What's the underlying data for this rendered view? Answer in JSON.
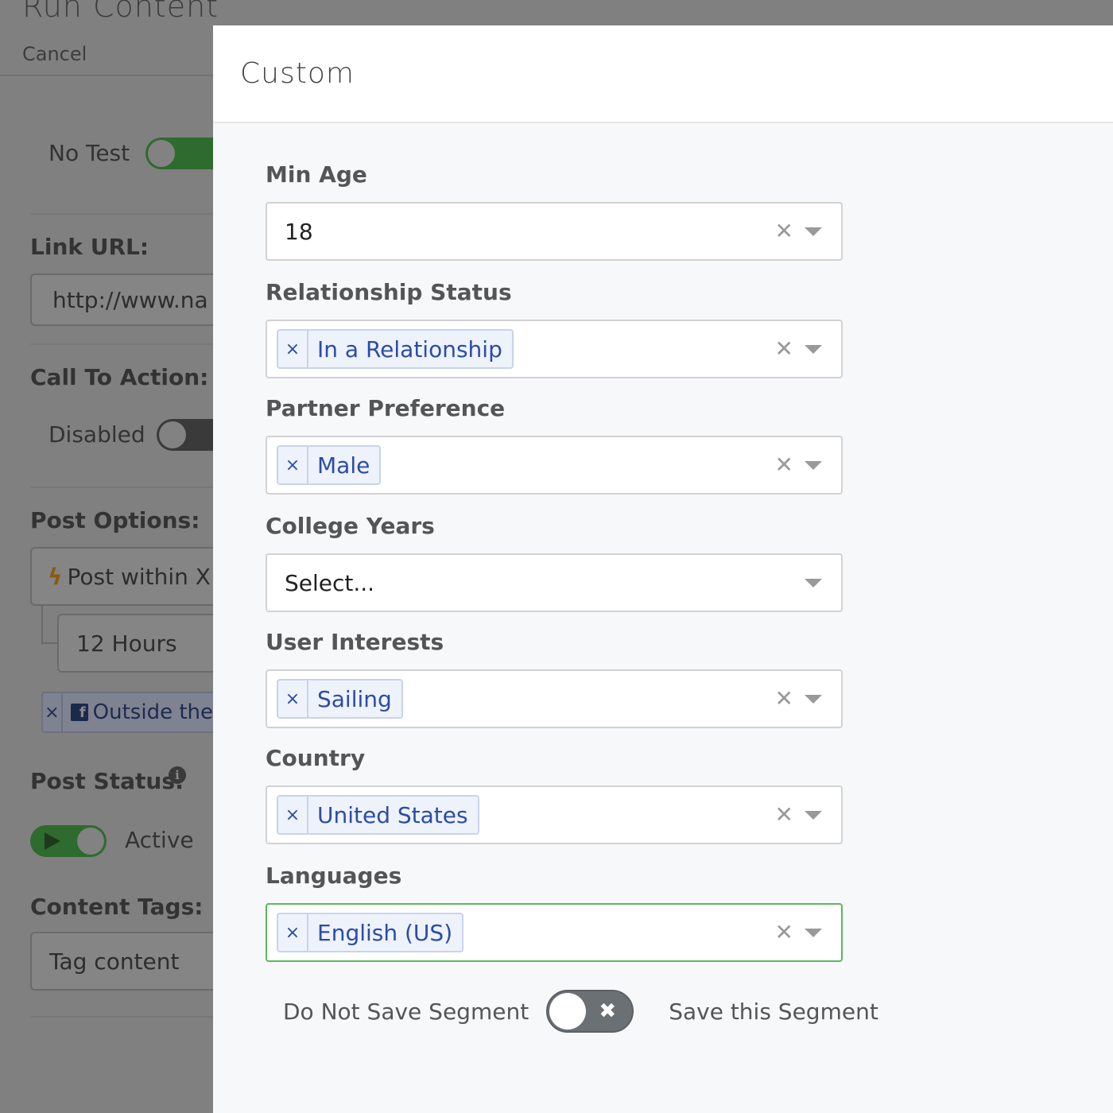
{
  "background": {
    "title": "Run Content",
    "cancel_label": "Cancel",
    "no_test_label": "No Test",
    "link_url_label": "Link URL:",
    "link_url_value": "http://www.na",
    "call_to_action_label": "Call To Action:",
    "disabled_label": "Disabled",
    "post_options_label": "Post Options:",
    "post_option_value": "Post within X I",
    "hours_value": "12 Hours",
    "outside_tag_label": "Outside the",
    "post_status_label": "Post Status:",
    "active_label": "Active",
    "content_tags_label": "Content Tags:",
    "tag_placeholder": "Tag content"
  },
  "modal": {
    "title": "Custom",
    "fields": {
      "min_age": {
        "label": "Min Age",
        "value": "18"
      },
      "relationship_status": {
        "label": "Relationship Status",
        "chip": "In a Relationship"
      },
      "partner_preference": {
        "label": "Partner Preference",
        "chip": "Male"
      },
      "college_years": {
        "label": "College Years",
        "placeholder": "Select..."
      },
      "user_interests": {
        "label": "User Interests",
        "chip": "Sailing"
      },
      "country": {
        "label": "Country",
        "chip": "United States"
      },
      "languages": {
        "label": "Languages",
        "chip": "English (US)"
      }
    },
    "segment": {
      "left_label": "Do Not Save Segment",
      "right_label": "Save this Segment"
    }
  },
  "icons": {
    "chip_remove": "×",
    "clear": "✕",
    "toggle_x": "✖",
    "info": "i",
    "bolt": "ϟ",
    "facebook": "f"
  },
  "colors": {
    "focus_border": "#5cb85c",
    "chip_text": "#2b4ca8",
    "toggle_off": "#6b7075"
  }
}
